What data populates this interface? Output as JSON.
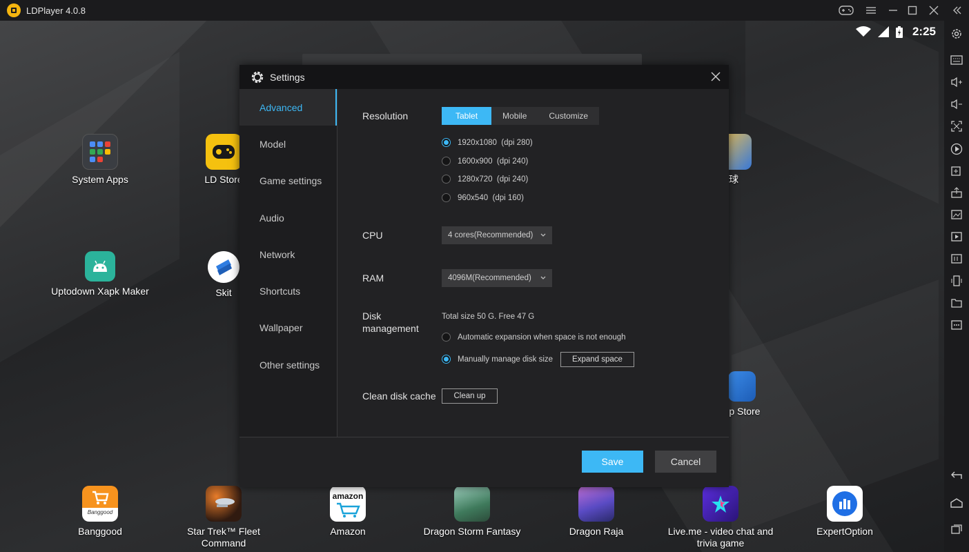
{
  "window": {
    "title": "LDPlayer 4.0.8"
  },
  "status_bar": {
    "time": "2:25"
  },
  "desktop": {
    "apps_top": [
      {
        "label": "System Apps",
        "icon": "system-apps-icon"
      },
      {
        "label": "LD Store",
        "icon": "ld-store-icon"
      },
      {
        "label": "球",
        "icon": "game-icon"
      }
    ],
    "apps_middle": [
      {
        "label": "Uptodown Xapk Maker",
        "icon": "android-icon"
      },
      {
        "label": "Skit",
        "icon": "skit-icon"
      },
      {
        "label": "pp Store",
        "icon": "app-store-icon"
      }
    ],
    "dock": [
      {
        "label": "Banggood",
        "icon": "banggood-icon",
        "sub": "Banggood"
      },
      {
        "label": "Star Trek™ Fleet Command",
        "icon": "star-trek-icon"
      },
      {
        "label": "Amazon",
        "icon": "amazon-icon",
        "sub": "amazon"
      },
      {
        "label": "Dragon Storm Fantasy",
        "icon": "dragon-storm-icon"
      },
      {
        "label": "Dragon Raja",
        "icon": "dragon-raja-icon"
      },
      {
        "label": "Live.me - video chat and trivia game",
        "icon": "liveme-icon"
      },
      {
        "label": "ExpertOption",
        "icon": "expertoption-icon"
      }
    ]
  },
  "settings": {
    "title": "Settings",
    "nav": [
      {
        "label": "Advanced",
        "active": true
      },
      {
        "label": "Model"
      },
      {
        "label": "Game settings"
      },
      {
        "label": "Audio"
      },
      {
        "label": "Network"
      },
      {
        "label": "Shortcuts"
      },
      {
        "label": "Wallpaper"
      },
      {
        "label": "Other settings"
      }
    ],
    "resolution": {
      "label": "Resolution",
      "tabs": [
        "Tablet",
        "Mobile",
        "Customize"
      ],
      "active_tab": "Tablet",
      "options": [
        {
          "label": "1920x1080  (dpi 280)",
          "selected": true
        },
        {
          "label": "1600x900  (dpi 240)",
          "selected": false
        },
        {
          "label": "1280x720  (dpi 240)",
          "selected": false
        },
        {
          "label": "960x540  (dpi 160)",
          "selected": false
        }
      ]
    },
    "cpu": {
      "label": "CPU",
      "value": "4 cores(Recommended)"
    },
    "ram": {
      "label": "RAM",
      "value": "4096M(Recommended)"
    },
    "disk": {
      "label_line1": "Disk",
      "label_line2": "management",
      "info": "Total size 50 G.  Free 47 G",
      "options": [
        {
          "label": "Automatic expansion when space is not enough",
          "selected": false
        },
        {
          "label": "Manually manage disk size",
          "selected": true
        }
      ],
      "expand_button": "Expand space"
    },
    "cache": {
      "label": "Clean disk cache",
      "button": "Clean up"
    },
    "save": "Save",
    "cancel": "Cancel"
  },
  "colors": {
    "accent": "#3db8f5",
    "titlebar": "#1b1b1d",
    "dialog_bg": "#222224"
  }
}
